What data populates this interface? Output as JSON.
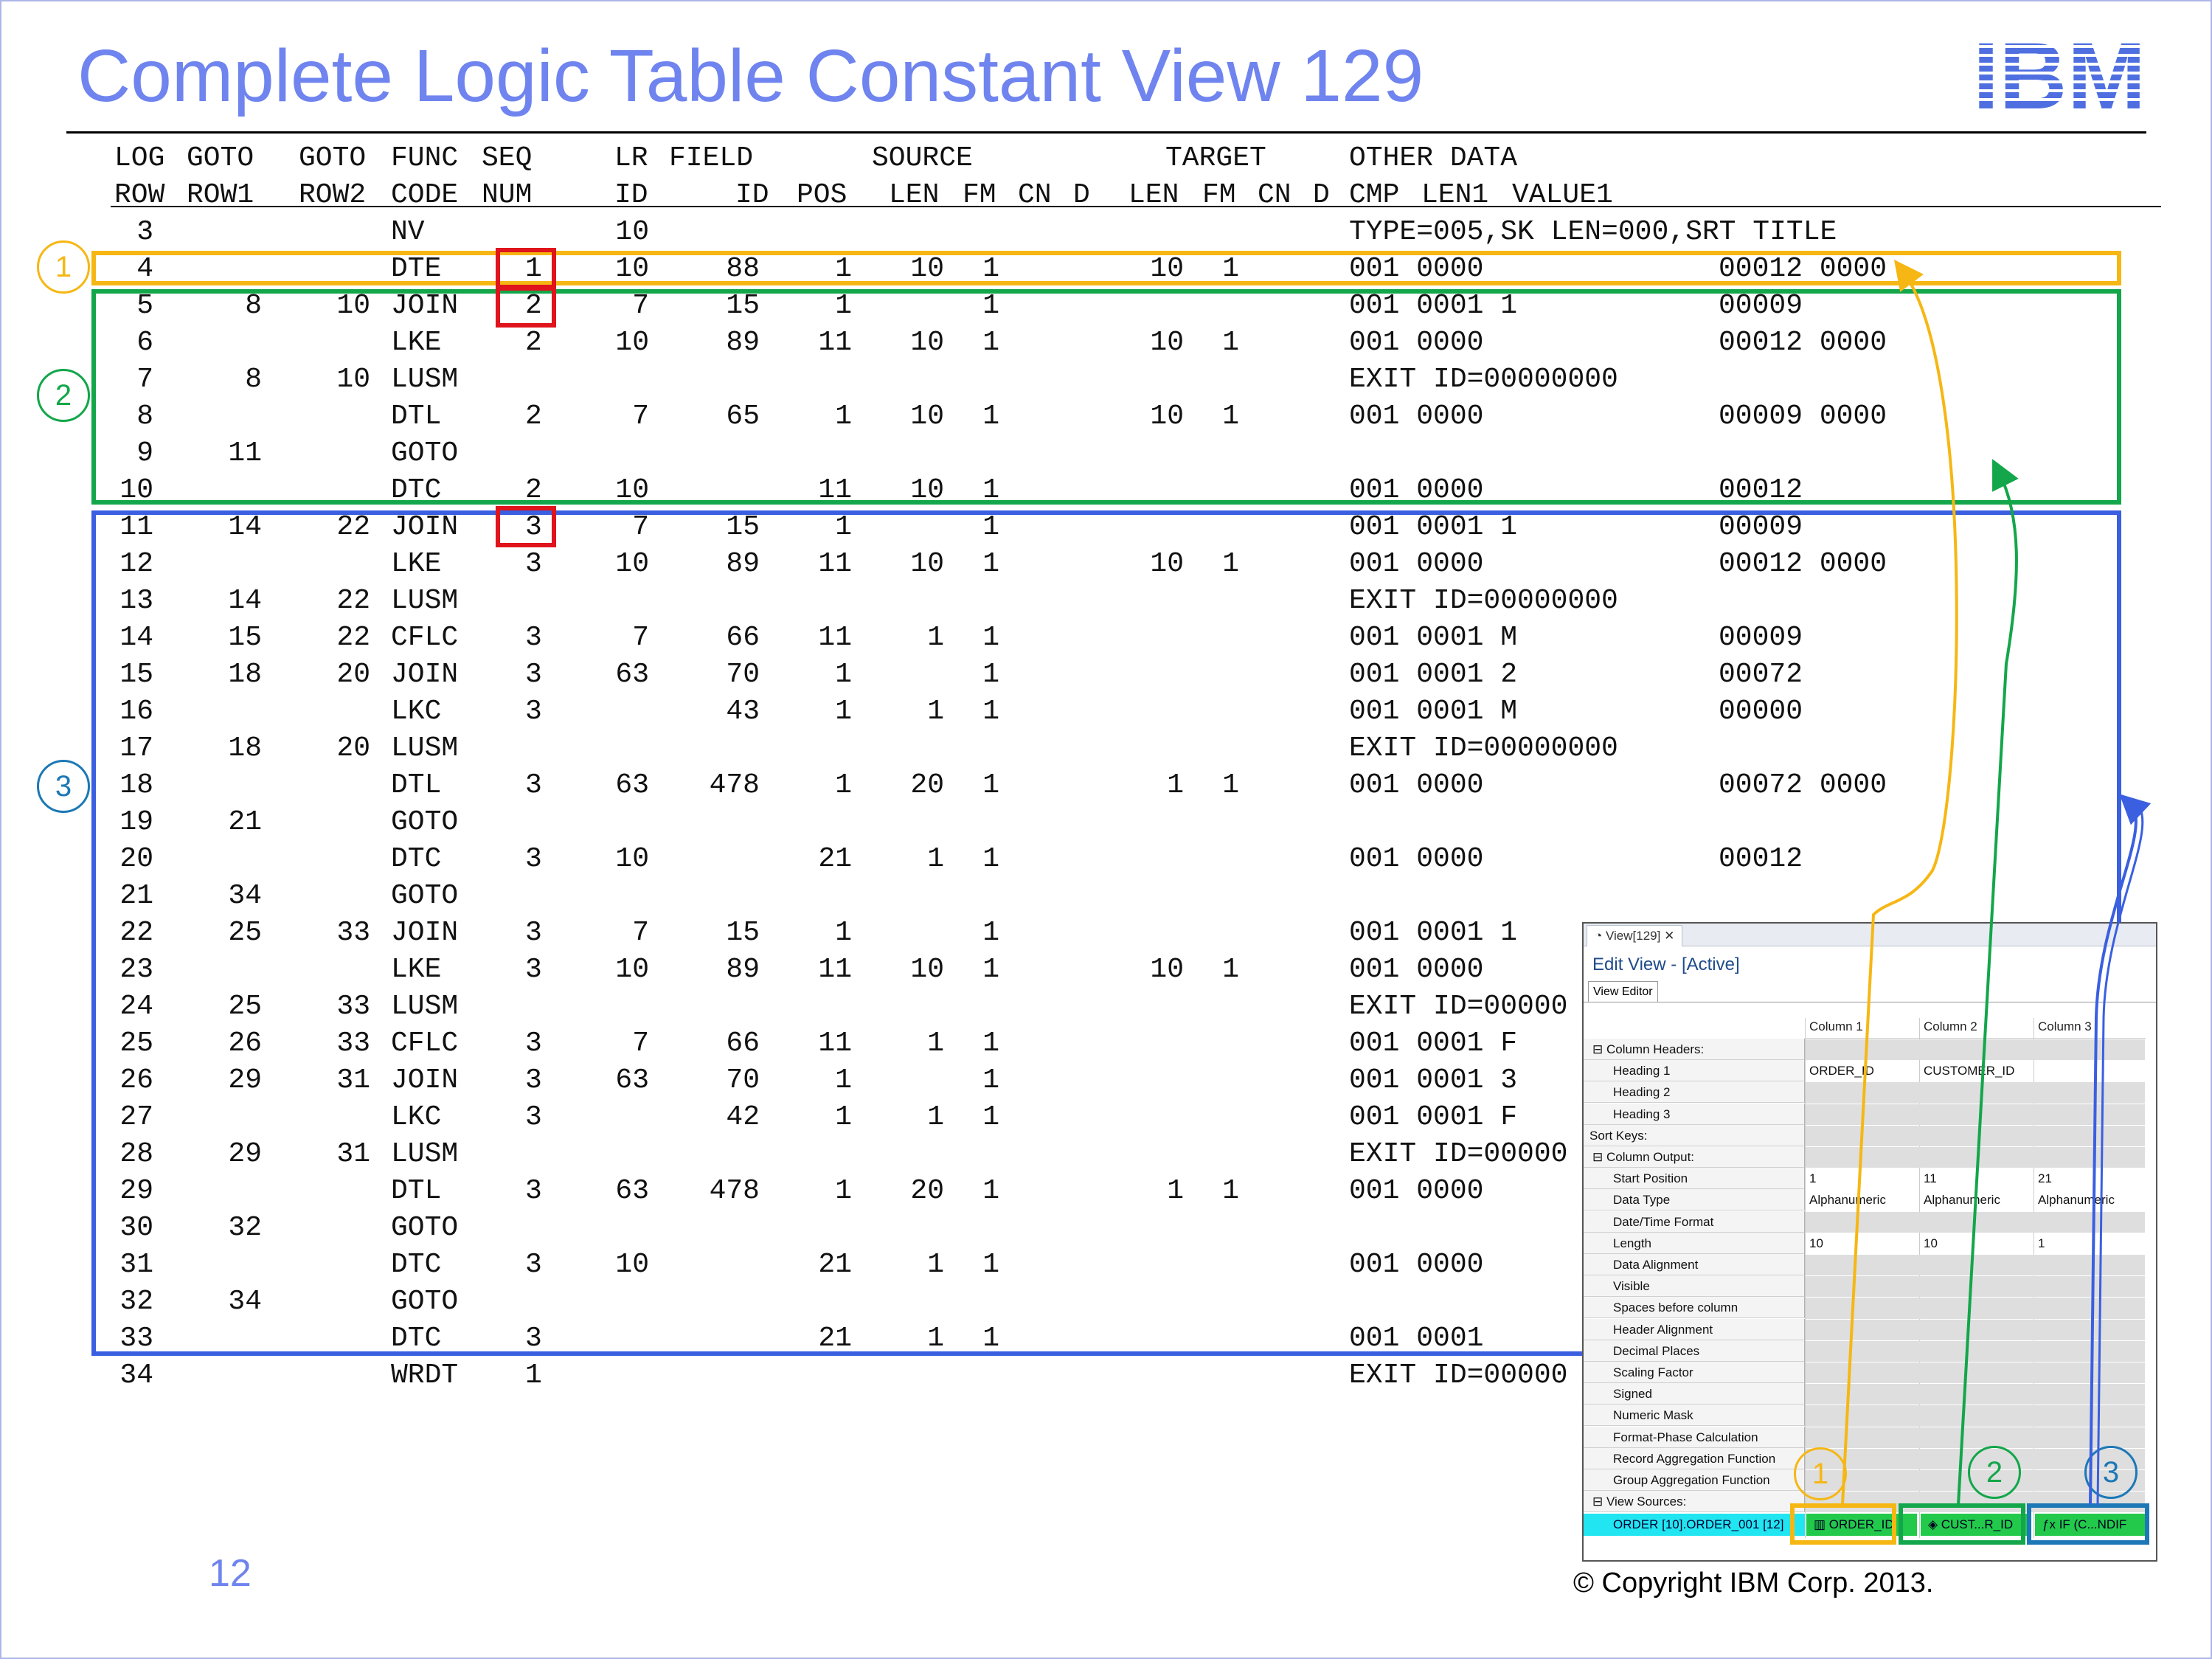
{
  "slide": {
    "title": "Complete Logic Table Constant View 129",
    "page_number": "12",
    "copyright": "© Copyright IBM Corp. 2013."
  },
  "logo": {
    "text": "IBM",
    "color": "#4f6fe0"
  },
  "header_row1": [
    "LOG",
    "GOTO",
    "GOTO",
    "FUNC",
    "SEQ",
    "LR",
    "FIELD",
    "SOURCE",
    "TARGET",
    "OTHER DATA"
  ],
  "header_row2": [
    "ROW",
    "ROW1",
    "ROW2",
    "CODE",
    "NUM",
    "ID",
    "ID",
    "POS",
    "LEN",
    "FM",
    "CN",
    "D",
    "LEN",
    "FM",
    "CN",
    "D",
    "CMP",
    "LEN1",
    "VALUE1"
  ],
  "rows": [
    {
      "row": "3",
      "g1": "",
      "g2": "",
      "func": "NV",
      "seq": "",
      "lr": "10",
      "field": "",
      "pos": "",
      "slen": "",
      "sfm": "",
      "tlen": "",
      "tfm": "",
      "cmp": "TYPE=005,SK LEN=000,SRT TITLE",
      "val": ""
    },
    {
      "row": "4",
      "g1": "",
      "g2": "",
      "func": "DTE",
      "seq": "1",
      "lr": "10",
      "field": "88",
      "pos": "1",
      "slen": "10",
      "sfm": "1",
      "tlen": "10",
      "tfm": "1",
      "cmp": "001 0000",
      "val": "00012 0000"
    },
    {
      "row": "5",
      "g1": "8",
      "g2": "10",
      "func": "JOIN",
      "seq": "2",
      "lr": "7",
      "field": "15",
      "pos": "1",
      "slen": "",
      "sfm": "1",
      "tlen": "",
      "tfm": "",
      "cmp": "001 0001 1",
      "val": "00009"
    },
    {
      "row": "6",
      "g1": "",
      "g2": "",
      "func": "LKE",
      "seq": "2",
      "lr": "10",
      "field": "89",
      "pos": "11",
      "slen": "10",
      "sfm": "1",
      "tlen": "10",
      "tfm": "1",
      "cmp": "001 0000",
      "val": "00012 0000"
    },
    {
      "row": "7",
      "g1": "8",
      "g2": "10",
      "func": "LUSM",
      "seq": "",
      "lr": "",
      "field": "",
      "pos": "",
      "slen": "",
      "sfm": "",
      "tlen": "",
      "tfm": "",
      "cmp": "EXIT ID=00000000",
      "val": ""
    },
    {
      "row": "8",
      "g1": "",
      "g2": "",
      "func": "DTL",
      "seq": "2",
      "lr": "7",
      "field": "65",
      "pos": "1",
      "slen": "10",
      "sfm": "1",
      "tlen": "10",
      "tfm": "1",
      "cmp": "001 0000",
      "val": "00009 0000"
    },
    {
      "row": "9",
      "g1": "11",
      "g2": "",
      "func": "GOTO",
      "seq": "",
      "lr": "",
      "field": "",
      "pos": "",
      "slen": "",
      "sfm": "",
      "tlen": "",
      "tfm": "",
      "cmp": "",
      "val": ""
    },
    {
      "row": "10",
      "g1": "",
      "g2": "",
      "func": "DTC",
      "seq": "2",
      "lr": "10",
      "field": "",
      "pos": "11",
      "slen": "10",
      "sfm": "1",
      "tlen": "",
      "tfm": "",
      "cmp": "001 0000",
      "val": "00012"
    },
    {
      "row": "11",
      "g1": "14",
      "g2": "22",
      "func": "JOIN",
      "seq": "3",
      "lr": "7",
      "field": "15",
      "pos": "1",
      "slen": "",
      "sfm": "1",
      "tlen": "",
      "tfm": "",
      "cmp": "001 0001 1",
      "val": "00009"
    },
    {
      "row": "12",
      "g1": "",
      "g2": "",
      "func": "LKE",
      "seq": "3",
      "lr": "10",
      "field": "89",
      "pos": "11",
      "slen": "10",
      "sfm": "1",
      "tlen": "10",
      "tfm": "1",
      "cmp": "001 0000",
      "val": "00012 0000"
    },
    {
      "row": "13",
      "g1": "14",
      "g2": "22",
      "func": "LUSM",
      "seq": "",
      "lr": "",
      "field": "",
      "pos": "",
      "slen": "",
      "sfm": "",
      "tlen": "",
      "tfm": "",
      "cmp": "EXIT ID=00000000",
      "val": ""
    },
    {
      "row": "14",
      "g1": "15",
      "g2": "22",
      "func": "CFLC",
      "seq": "3",
      "lr": "7",
      "field": "66",
      "pos": "11",
      "slen": "1",
      "sfm": "1",
      "tlen": "",
      "tfm": "",
      "cmp": "001 0001 M",
      "val": "00009"
    },
    {
      "row": "15",
      "g1": "18",
      "g2": "20",
      "func": "JOIN",
      "seq": "3",
      "lr": "63",
      "field": "70",
      "pos": "1",
      "slen": "",
      "sfm": "1",
      "tlen": "",
      "tfm": "",
      "cmp": "001 0001 2",
      "val": "00072"
    },
    {
      "row": "16",
      "g1": "",
      "g2": "",
      "func": "LKC",
      "seq": "3",
      "lr": "",
      "field": "43",
      "pos": "1",
      "slen": "1",
      "sfm": "1",
      "tlen": "",
      "tfm": "",
      "cmp": "001 0001 M",
      "val": "00000"
    },
    {
      "row": "17",
      "g1": "18",
      "g2": "20",
      "func": "LUSM",
      "seq": "",
      "lr": "",
      "field": "",
      "pos": "",
      "slen": "",
      "sfm": "",
      "tlen": "",
      "tfm": "",
      "cmp": "EXIT ID=00000000",
      "val": ""
    },
    {
      "row": "18",
      "g1": "",
      "g2": "",
      "func": "DTL",
      "seq": "3",
      "lr": "63",
      "field": "478",
      "pos": "1",
      "slen": "20",
      "sfm": "1",
      "tlen": "1",
      "tfm": "1",
      "cmp": "001 0000",
      "val": "00072 0000"
    },
    {
      "row": "19",
      "g1": "21",
      "g2": "",
      "func": "GOTO",
      "seq": "",
      "lr": "",
      "field": "",
      "pos": "",
      "slen": "",
      "sfm": "",
      "tlen": "",
      "tfm": "",
      "cmp": "",
      "val": ""
    },
    {
      "row": "20",
      "g1": "",
      "g2": "",
      "func": "DTC",
      "seq": "3",
      "lr": "10",
      "field": "",
      "pos": "21",
      "slen": "1",
      "sfm": "1",
      "tlen": "",
      "tfm": "",
      "cmp": "001 0000",
      "val": "00012"
    },
    {
      "row": "21",
      "g1": "34",
      "g2": "",
      "func": "GOTO",
      "seq": "",
      "lr": "",
      "field": "",
      "pos": "",
      "slen": "",
      "sfm": "",
      "tlen": "",
      "tfm": "",
      "cmp": "",
      "val": ""
    },
    {
      "row": "22",
      "g1": "25",
      "g2": "33",
      "func": "JOIN",
      "seq": "3",
      "lr": "7",
      "field": "15",
      "pos": "1",
      "slen": "",
      "sfm": "1",
      "tlen": "",
      "tfm": "",
      "cmp": "001 0001 1",
      "val": ""
    },
    {
      "row": "23",
      "g1": "",
      "g2": "",
      "func": "LKE",
      "seq": "3",
      "lr": "10",
      "field": "89",
      "pos": "11",
      "slen": "10",
      "sfm": "1",
      "tlen": "10",
      "tfm": "1",
      "cmp": "001 0000",
      "val": ""
    },
    {
      "row": "24",
      "g1": "25",
      "g2": "33",
      "func": "LUSM",
      "seq": "",
      "lr": "",
      "field": "",
      "pos": "",
      "slen": "",
      "sfm": "",
      "tlen": "",
      "tfm": "",
      "cmp": "EXIT ID=00000",
      "val": ""
    },
    {
      "row": "25",
      "g1": "26",
      "g2": "33",
      "func": "CFLC",
      "seq": "3",
      "lr": "7",
      "field": "66",
      "pos": "11",
      "slen": "1",
      "sfm": "1",
      "tlen": "",
      "tfm": "",
      "cmp": "001 0001 F",
      "val": ""
    },
    {
      "row": "26",
      "g1": "29",
      "g2": "31",
      "func": "JOIN",
      "seq": "3",
      "lr": "63",
      "field": "70",
      "pos": "1",
      "slen": "",
      "sfm": "1",
      "tlen": "",
      "tfm": "",
      "cmp": "001 0001 3",
      "val": ""
    },
    {
      "row": "27",
      "g1": "",
      "g2": "",
      "func": "LKC",
      "seq": "3",
      "lr": "",
      "field": "42",
      "pos": "1",
      "slen": "1",
      "sfm": "1",
      "tlen": "",
      "tfm": "",
      "cmp": "001 0001 F",
      "val": ""
    },
    {
      "row": "28",
      "g1": "29",
      "g2": "31",
      "func": "LUSM",
      "seq": "",
      "lr": "",
      "field": "",
      "pos": "",
      "slen": "",
      "sfm": "",
      "tlen": "",
      "tfm": "",
      "cmp": "EXIT ID=00000",
      "val": ""
    },
    {
      "row": "29",
      "g1": "",
      "g2": "",
      "func": "DTL",
      "seq": "3",
      "lr": "63",
      "field": "478",
      "pos": "1",
      "slen": "20",
      "sfm": "1",
      "tlen": "1",
      "tfm": "1",
      "cmp": "001 0000",
      "val": ""
    },
    {
      "row": "30",
      "g1": "32",
      "g2": "",
      "func": "GOTO",
      "seq": "",
      "lr": "",
      "field": "",
      "pos": "",
      "slen": "",
      "sfm": "",
      "tlen": "",
      "tfm": "",
      "cmp": "",
      "val": ""
    },
    {
      "row": "31",
      "g1": "",
      "g2": "",
      "func": "DTC",
      "seq": "3",
      "lr": "10",
      "field": "",
      "pos": "21",
      "slen": "1",
      "sfm": "1",
      "tlen": "",
      "tfm": "",
      "cmp": "001 0000",
      "val": ""
    },
    {
      "row": "32",
      "g1": "34",
      "g2": "",
      "func": "GOTO",
      "seq": "",
      "lr": "",
      "field": "",
      "pos": "",
      "slen": "",
      "sfm": "",
      "tlen": "",
      "tfm": "",
      "cmp": "",
      "val": ""
    },
    {
      "row": "33",
      "g1": "",
      "g2": "",
      "func": "DTC",
      "seq": "3",
      "lr": "",
      "field": "",
      "pos": "21",
      "slen": "1",
      "sfm": "1",
      "tlen": "",
      "tfm": "",
      "cmp": "001 0001",
      "val": ""
    },
    {
      "row": "34",
      "g1": "",
      "g2": "",
      "func": "WRDT",
      "seq": "1",
      "lr": "",
      "field": "",
      "pos": "",
      "slen": "",
      "sfm": "",
      "tlen": "",
      "tfm": "",
      "cmp": "EXIT ID=00000",
      "val": ""
    }
  ],
  "markers": [
    "1",
    "2",
    "3"
  ],
  "colors": {
    "title": "#6f84ee",
    "yellow": "#f6b714",
    "green": "#13a64a",
    "blue": "#3a5fe0",
    "marker3": "#1c78b6",
    "red": "#e0141c"
  },
  "inset": {
    "tab_label": "View[129]",
    "heading": "Edit View - [Active]",
    "subtab": "View Editor",
    "columns": [
      "Column 1",
      "Column 2",
      "Column 3"
    ],
    "properties": [
      {
        "label": "Column Headers:",
        "values": [
          "",
          "",
          ""
        ]
      },
      {
        "label": "Heading 1",
        "values": [
          "ORDER_ID",
          "CUSTOMER_ID",
          ""
        ]
      },
      {
        "label": "Heading 2",
        "values": [
          "",
          "",
          ""
        ]
      },
      {
        "label": "Heading 3",
        "values": [
          "",
          "",
          ""
        ]
      },
      {
        "label": "Sort Keys:",
        "values": [
          "",
          "",
          ""
        ]
      },
      {
        "label": "Column Output:",
        "values": [
          "",
          "",
          ""
        ]
      },
      {
        "label": "Start Position",
        "values": [
          "1",
          "11",
          "21"
        ]
      },
      {
        "label": "Data Type",
        "values": [
          "Alphanumeric",
          "Alphanumeric",
          "Alphanumeric"
        ]
      },
      {
        "label": "Date/Time Format",
        "values": [
          "",
          "",
          ""
        ]
      },
      {
        "label": "Length",
        "values": [
          "10",
          "10",
          "1"
        ]
      },
      {
        "label": "Data Alignment",
        "values": [
          "",
          "",
          ""
        ]
      },
      {
        "label": "Visible",
        "values": [
          "",
          "",
          ""
        ]
      },
      {
        "label": "Spaces before column",
        "values": [
          "",
          "",
          ""
        ]
      },
      {
        "label": "Header Alignment",
        "values": [
          "",
          "",
          ""
        ]
      },
      {
        "label": "Decimal Places",
        "values": [
          "",
          "",
          ""
        ]
      },
      {
        "label": "Scaling Factor",
        "values": [
          "",
          "",
          ""
        ]
      },
      {
        "label": "Signed",
        "values": [
          "",
          "",
          ""
        ]
      },
      {
        "label": "Numeric Mask",
        "values": [
          "",
          "",
          ""
        ]
      },
      {
        "label": "Format-Phase Calculation",
        "values": [
          "",
          "",
          ""
        ]
      },
      {
        "label": "Record Aggregation Function",
        "values": [
          "",
          "",
          ""
        ]
      },
      {
        "label": "Group Aggregation Function",
        "values": [
          "",
          "",
          ""
        ]
      },
      {
        "label": "View Sources:",
        "values": [
          "",
          "",
          ""
        ]
      }
    ],
    "view_source": "ORDER [10].ORDER_001 [12]",
    "source_cells": [
      "ORDER_ID",
      "CUST...R_ID",
      "IF (C...NDIF"
    ]
  }
}
